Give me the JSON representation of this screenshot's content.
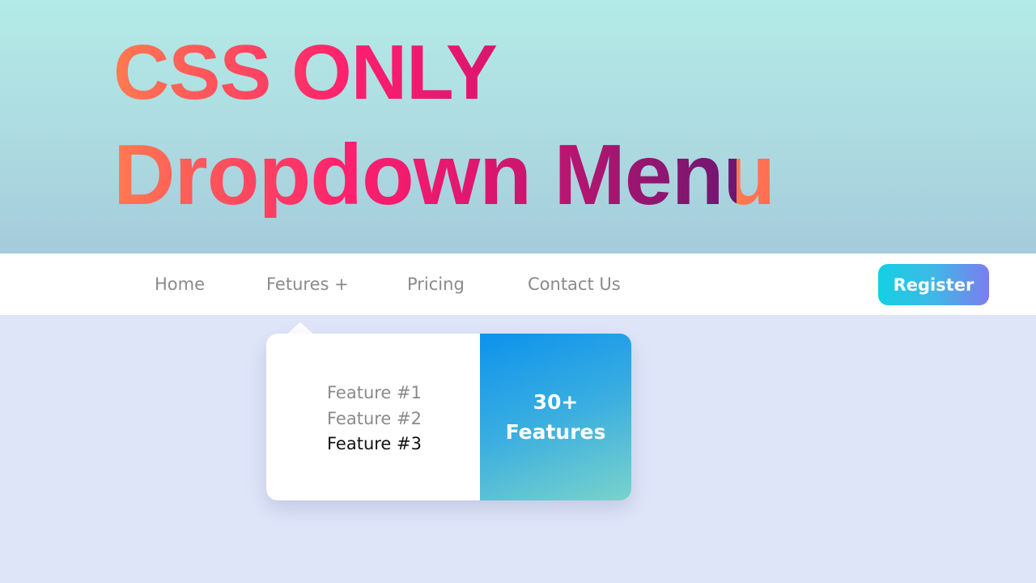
{
  "banner": {
    "title_line1": "CSS ONLY",
    "title_line2": "Dropdown Menu"
  },
  "navbar": {
    "links": [
      {
        "label": "Home"
      },
      {
        "label": "Fetures +"
      },
      {
        "label": "Pricing"
      },
      {
        "label": "Contact Us"
      }
    ],
    "register_label": "Register"
  },
  "dropdown": {
    "items": [
      {
        "label": "Feature #1",
        "active": false
      },
      {
        "label": "Feature #2",
        "active": false
      },
      {
        "label": "Feature #3",
        "active": true
      }
    ],
    "promo": {
      "line1": "30+",
      "line2": "Features"
    }
  },
  "colors": {
    "accent_gradient_start": "#13d0e3",
    "accent_gradient_end": "#7c7cf0",
    "title_gradient_start": "#ff7a4f",
    "title_gradient_mid": "#ff1f6e",
    "title_gradient_end": "#6d1670",
    "promo_gradient_start": "#0d92ec",
    "promo_gradient_end": "#7ad3cb",
    "page_background": "#dfe5f9"
  }
}
